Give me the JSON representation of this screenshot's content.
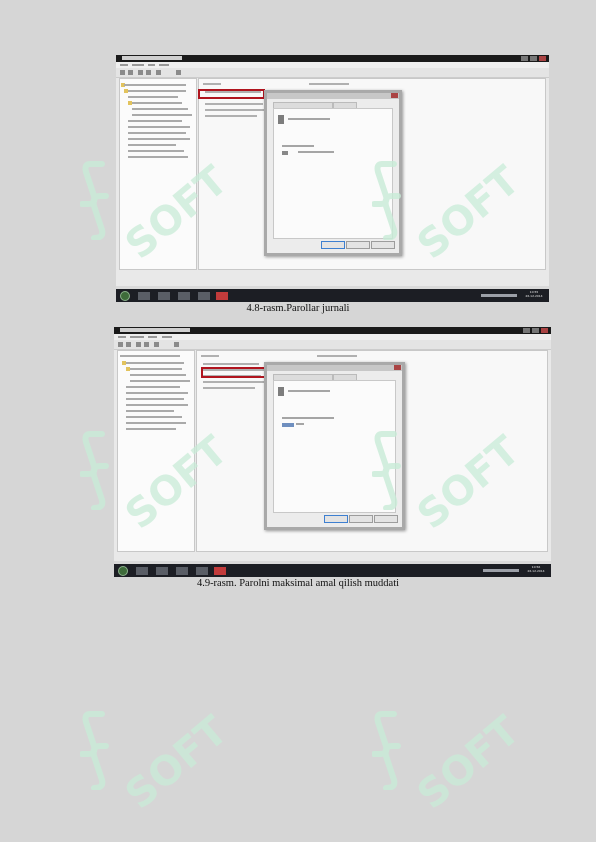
{
  "figures": [
    {
      "caption": "4.8-rasm.Parollar jurnali",
      "clock_time": "10:55",
      "clock_date": "26.12.2014"
    },
    {
      "caption": "4.9-rasm. Parolni maksimal amal qilish muddati",
      "clock_time": "10:56",
      "clock_date": "26.12.2014"
    }
  ],
  "watermark": {
    "text": "SOFT",
    "color": "#c9ecd8"
  },
  "colors": {
    "page_background": "#d6d6d6",
    "highlight_border": "#b0141e",
    "taskbar": "#1c1e24"
  }
}
